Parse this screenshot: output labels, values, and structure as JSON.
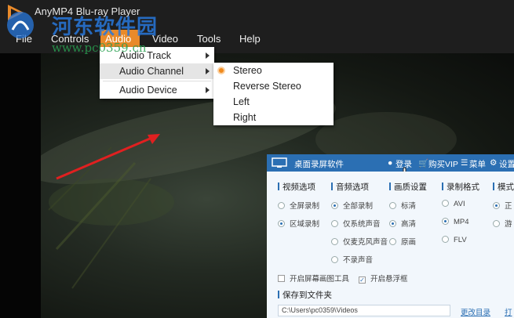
{
  "app": {
    "title": "AnyMP4 Blu-ray Player"
  },
  "menubar": {
    "items": [
      "File",
      "Controls",
      "Audio",
      "Video",
      "Tools",
      "Help"
    ]
  },
  "audio_menu": {
    "items": [
      "Audio Track",
      "Audio Channel",
      "Audio Device"
    ]
  },
  "channel_menu": {
    "items": [
      "Stereo",
      "Reverse Stereo",
      "Left",
      "Right"
    ],
    "selected": "Stereo"
  },
  "watermark": {
    "title": "河东软件园",
    "url": "www.pc0359.cn"
  },
  "recorder": {
    "title": "桌面录屏软件",
    "login": "登录",
    "vip": "购买VIP",
    "menu": "菜单",
    "settings": "设置",
    "sections": {
      "video": {
        "title": "视频选项",
        "options": [
          "全屏录制",
          "区域录制"
        ],
        "selected": "区域录制"
      },
      "audio": {
        "title": "音频选项",
        "options": [
          "全部录制",
          "仅系统声音",
          "仅麦克风声音",
          "不录声音"
        ],
        "selected": "全部录制"
      },
      "quality": {
        "title": "画质设置",
        "options": [
          "标清",
          "高清",
          "原画"
        ],
        "selected": "高清"
      },
      "format": {
        "title": "录制格式",
        "options": [
          "AVI",
          "MP4",
          "FLV"
        ],
        "selected": "MP4"
      },
      "mode": {
        "title": "模式",
        "options": [
          "正",
          "游"
        ],
        "selected": "正"
      }
    },
    "checkbox_screenshot": "开启屏幕画图工具",
    "checkbox_float": "开启悬浮框",
    "save_title": "保存到文件夹",
    "save_path": "C:\\Users\\pc0359\\Videos",
    "change_dir": "更改目录",
    "open": "打"
  },
  "colors": {
    "accent": "#e98a2a",
    "recorder_blue": "#2b6fb3",
    "menubar_bg": "#1e1e1e"
  }
}
